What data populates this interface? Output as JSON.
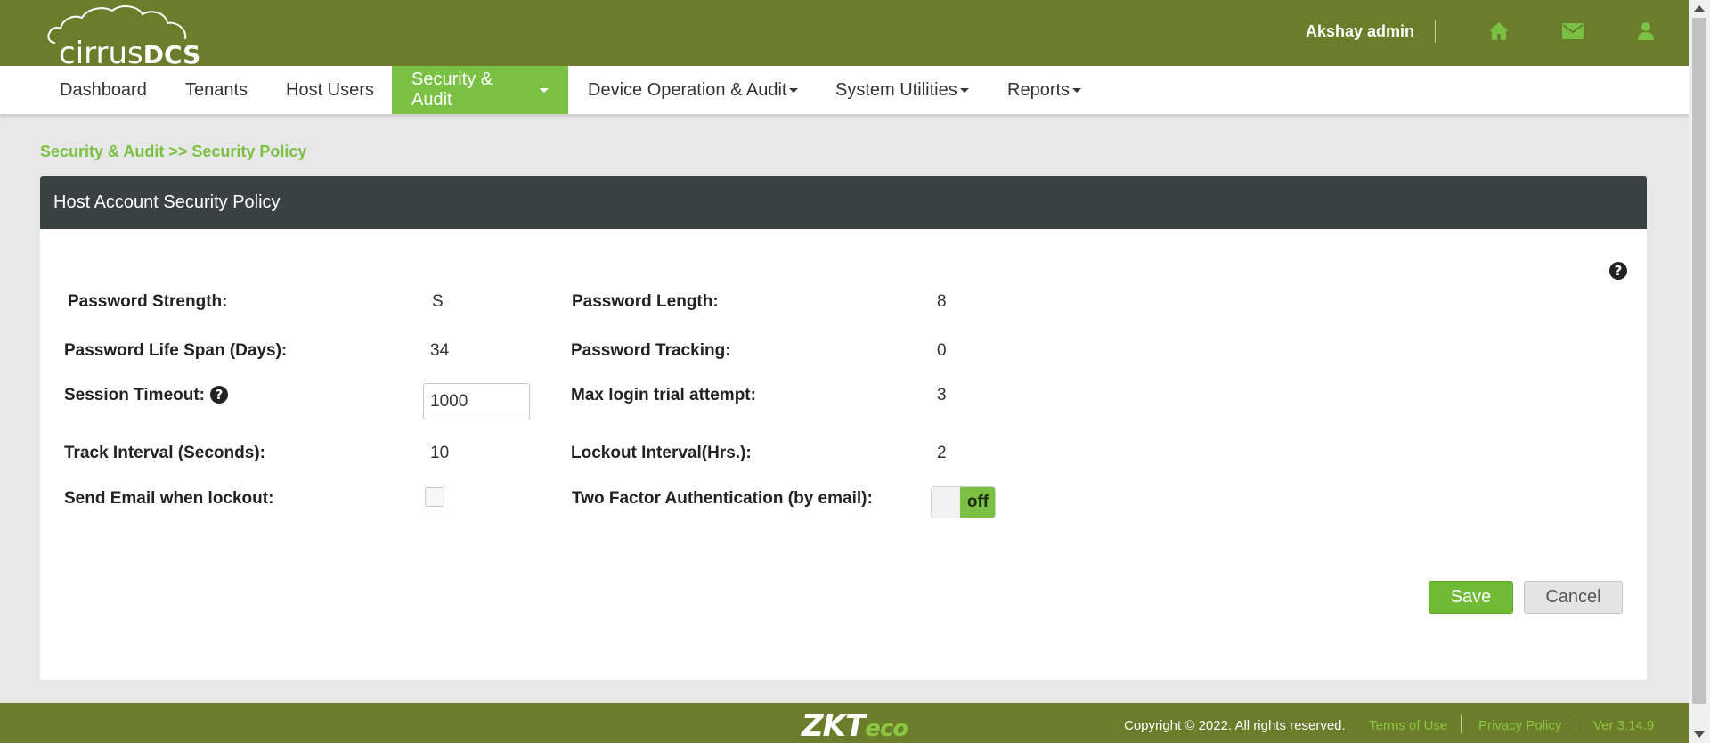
{
  "header": {
    "logo_text_cirrus": "cirrus",
    "logo_text_dcs": "DCS",
    "user_name": "Akshay admin",
    "icons": [
      "home-icon",
      "envelope-icon",
      "user-icon"
    ]
  },
  "nav": {
    "items": [
      {
        "label": "Dashboard",
        "dropdown": false,
        "active": false
      },
      {
        "label": "Tenants",
        "dropdown": false,
        "active": false
      },
      {
        "label": "Host Users",
        "dropdown": false,
        "active": false
      },
      {
        "label": "Security & Audit",
        "dropdown": true,
        "active": true
      },
      {
        "label": "Device Operation & Audit",
        "dropdown": true,
        "active": false
      },
      {
        "label": "System Utilities",
        "dropdown": true,
        "active": false
      },
      {
        "label": "Reports",
        "dropdown": true,
        "active": false
      }
    ]
  },
  "breadcrumb": "Security & Audit >> Security Policy",
  "panel": {
    "title": "Host Account Security Policy",
    "fields": {
      "password_strength": {
        "label": "Password Strength:",
        "value": "S"
      },
      "password_length": {
        "label": "Password Length:",
        "value": "8"
      },
      "password_life_span": {
        "label": "Password Life Span (Days):",
        "value": "34"
      },
      "password_tracking": {
        "label": "Password Tracking:",
        "value": "0"
      },
      "session_timeout": {
        "label": "Session Timeout:",
        "value": "1000"
      },
      "max_login_trial": {
        "label": "Max login trial attempt:",
        "value": "3"
      },
      "track_interval": {
        "label": "Track Interval (Seconds):",
        "value": "10"
      },
      "lockout_interval": {
        "label": "Lockout Interval(Hrs.):",
        "value": "2"
      },
      "send_email_lockout": {
        "label": "Send Email when lockout:",
        "checked": false
      },
      "two_factor": {
        "label": "Two Factor Authentication (by email):",
        "state": "off"
      }
    },
    "buttons": {
      "save": "Save",
      "cancel": "Cancel"
    }
  },
  "footer": {
    "logo_zkt": "ZKT",
    "logo_eco": "eco",
    "copyright": "Copyright © 2022. All rights reserved.",
    "terms": "Terms of Use",
    "privacy": "Privacy Policy",
    "version": "Ver 3.14.9"
  },
  "colors": {
    "header_bg": "#6b7d2a",
    "accent_green": "#7ac143",
    "panel_header_bg": "#3b4043"
  }
}
